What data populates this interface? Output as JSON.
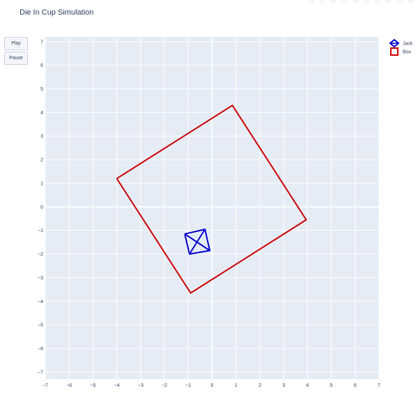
{
  "title": "Die In Cup Simulation",
  "buttons": {
    "play": "Play",
    "pause": "Pause"
  },
  "modebar_icons": [
    "camera-icon",
    "zoom-icon",
    "pan-icon",
    "box-select-icon",
    "lasso-icon",
    "zoom-in-icon",
    "zoom-out-icon",
    "autoscale-icon",
    "reset-axes-icon",
    "plotly-logo-icon"
  ],
  "chart_data": {
    "type": "line",
    "xlim": [
      -7,
      7
    ],
    "ylim": [
      -7.3,
      7.2
    ],
    "xticks": [
      -7,
      -6,
      -5,
      -4,
      -3,
      -2,
      -1,
      0,
      1,
      2,
      3,
      4,
      5,
      6,
      7
    ],
    "yticks": [
      -7,
      -6,
      -5,
      -4,
      -3,
      -2,
      -1,
      0,
      1,
      2,
      3,
      4,
      5,
      6,
      7
    ],
    "grid": true,
    "legend_position": "top-right",
    "series": [
      {
        "name": "Jack",
        "color": "#0000cc",
        "segments": [
          [
            [
              -1.15,
              -1.15
            ],
            [
              -0.3,
              -0.95
            ],
            [
              -0.1,
              -1.85
            ],
            [
              -0.95,
              -2.0
            ],
            [
              -1.15,
              -1.15
            ]
          ],
          [
            [
              -1.15,
              -1.15
            ],
            [
              -0.1,
              -1.85
            ]
          ],
          [
            [
              -0.3,
              -0.95
            ],
            [
              -0.95,
              -2.0
            ]
          ]
        ]
      },
      {
        "name": "Box",
        "color": "#cc0000",
        "segments": [
          [
            [
              -4.0,
              1.2
            ],
            [
              0.85,
              4.3
            ],
            [
              3.95,
              -0.55
            ],
            [
              -0.9,
              -3.65
            ],
            [
              -4.0,
              1.2
            ]
          ]
        ]
      }
    ]
  }
}
